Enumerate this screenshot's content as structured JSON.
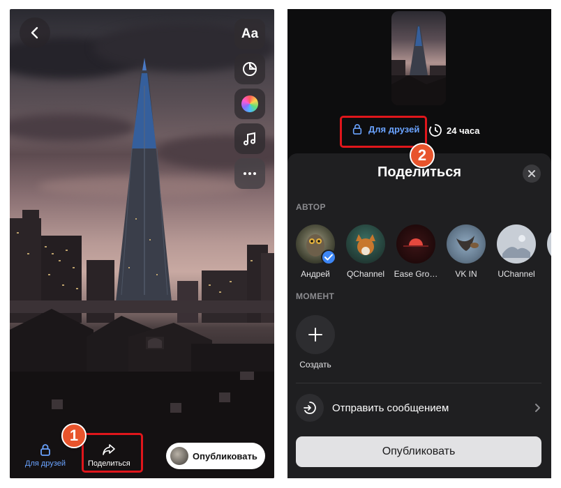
{
  "left_screen": {
    "tools": {
      "text_tool_label": "Aa",
      "sticker_icon": "sticker-icon",
      "color_icon": "color-wheel-icon",
      "music_icon": "music-note-icon",
      "more_icon": "more-dots-icon"
    },
    "bottom": {
      "privacy_label": "Для друзей",
      "share_label": "Поделиться",
      "publish_label": "Опубликовать"
    },
    "annotation_1": "1"
  },
  "right_screen": {
    "privacy_label": "Для друзей",
    "duration_label": "24 часа",
    "annotation_2": "2",
    "sheet": {
      "title": "Поделиться",
      "author_section": "АВТОР",
      "authors": [
        {
          "name": "Андрей",
          "selected": true
        },
        {
          "name": "QChannel",
          "selected": false
        },
        {
          "name": "Ease Gro…",
          "selected": false
        },
        {
          "name": "VK IN",
          "selected": false
        },
        {
          "name": "UChannel",
          "selected": false
        }
      ],
      "moment_section": "МОМЕНТ",
      "create_label": "Создать",
      "send_message_label": "Отправить сообщением",
      "publish_label": "Опубликовать"
    }
  },
  "colors": {
    "accent_blue": "#6aa3ff",
    "annotation_red": "#e0161b",
    "badge_orange": "#e8542c"
  }
}
